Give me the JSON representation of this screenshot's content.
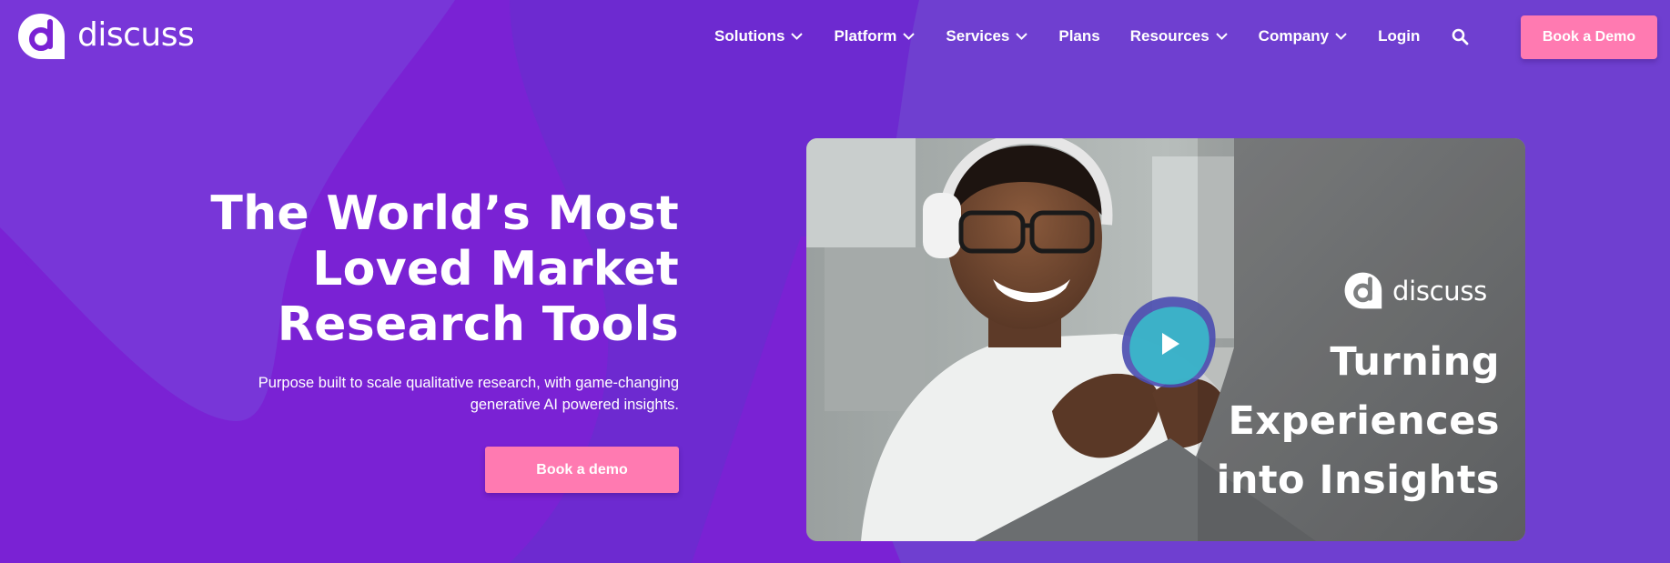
{
  "brand": {
    "name": "discuss",
    "accent": "#ff7ab1",
    "background": "#7a23d6"
  },
  "nav": {
    "items": [
      {
        "label": "Solutions",
        "has_dropdown": true,
        "icon": "chevron-down-icon"
      },
      {
        "label": "Platform",
        "has_dropdown": true,
        "icon": "chevron-down-icon"
      },
      {
        "label": "Services",
        "has_dropdown": true,
        "icon": "chevron-down-icon"
      },
      {
        "label": "Plans",
        "has_dropdown": false
      },
      {
        "label": "Resources",
        "has_dropdown": true,
        "icon": "chevron-down-icon"
      },
      {
        "label": "Company",
        "has_dropdown": true,
        "icon": "chevron-down-icon"
      },
      {
        "label": "Login",
        "has_dropdown": false
      }
    ],
    "search_icon": "search-icon",
    "cta_label": "Book a Demo"
  },
  "hero": {
    "headline_lines": [
      "The World’s Most",
      "Loved Market",
      "Research Tools"
    ],
    "subtext_lines": [
      "Purpose built to scale qualitative research, with game-changing",
      "generative AI powered insights."
    ],
    "cta_label": "Book a demo"
  },
  "video": {
    "brand_name": "discuss",
    "tagline_lines": [
      "Turning",
      "Experiences",
      "into Insights"
    ],
    "play_icon": "play-icon"
  }
}
